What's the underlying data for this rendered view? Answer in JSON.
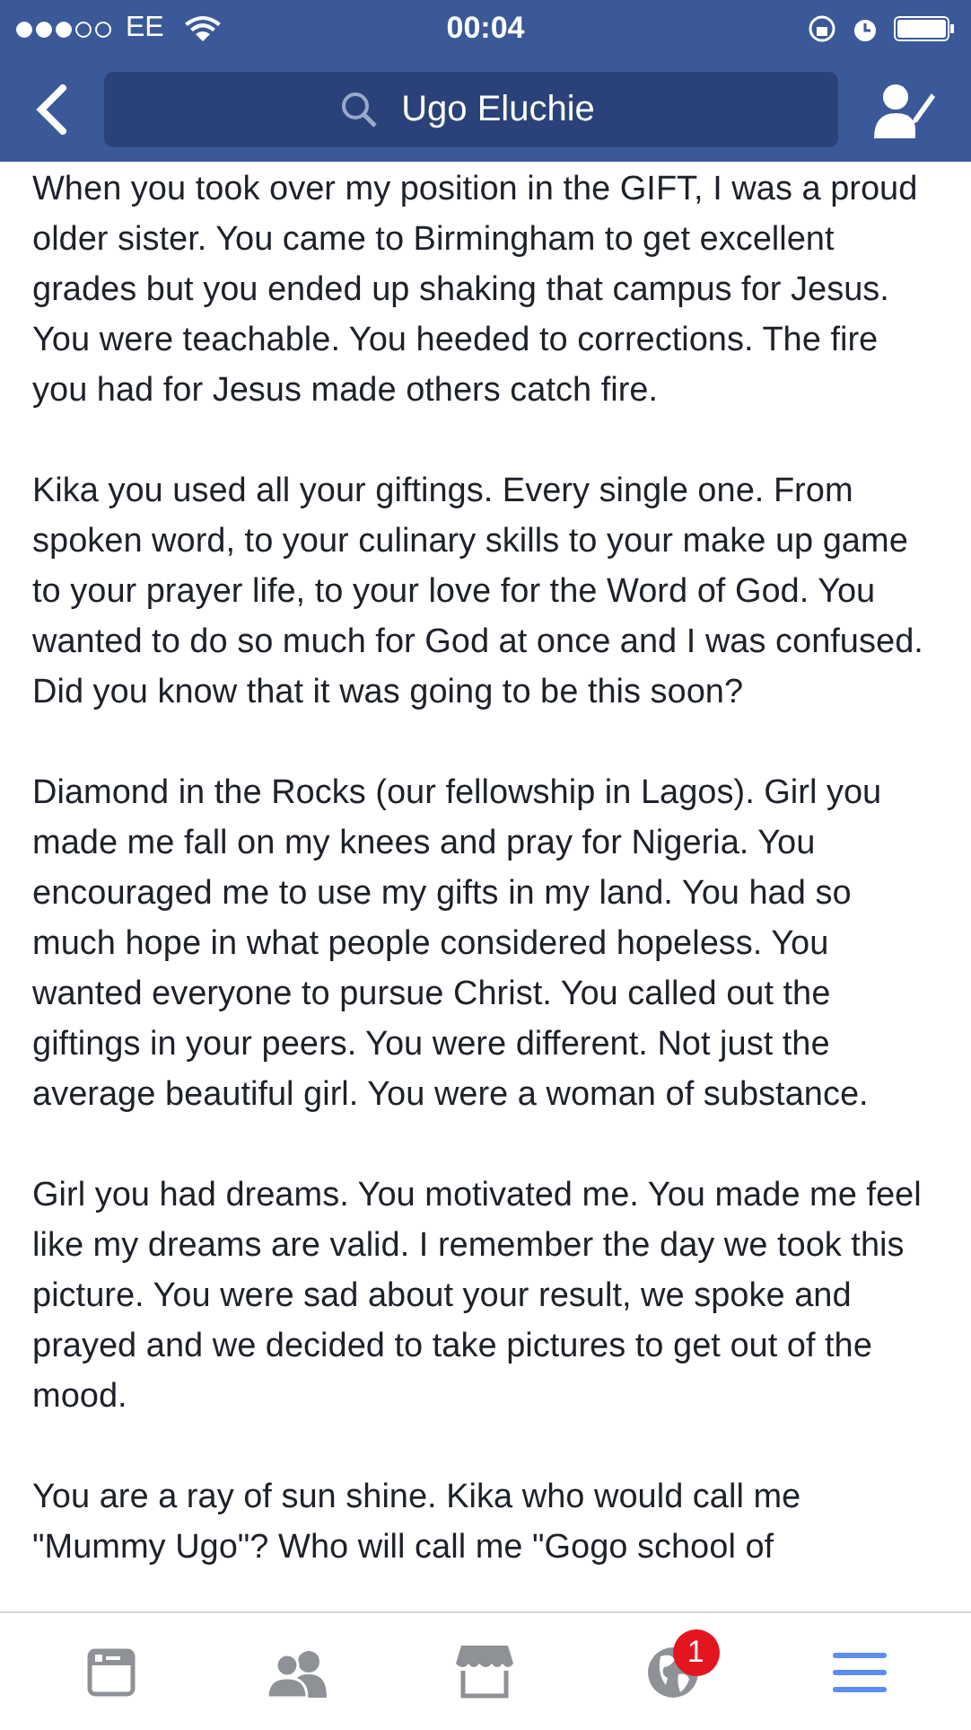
{
  "status_bar": {
    "carrier": "EE",
    "time": "00:04"
  },
  "nav_bar": {
    "search": {
      "value": "Ugo Eluchie"
    }
  },
  "post": {
    "paragraphs": [
      "When you took over my position in the GIFT, I was a proud older sister. You came to Birmingham to get excellent grades but you ended up shaking that campus for Jesus. You were teachable. You heeded to corrections. The fire you had for Jesus made others catch fire.",
      "Kika you used all your giftings. Every single one. From spoken word, to your culinary skills to your make up game to your prayer life, to your love for the Word of God. You wanted to do so much for God at once and I was confused. Did you know that it was going to be this soon?",
      "Diamond in the Rocks (our fellowship in Lagos). Girl you made me fall on my knees and pray for Nigeria. You encouraged me to use my gifts in my land. You had so much hope in what people considered hopeless. You wanted everyone to pursue Christ. You called out the giftings in your peers. You were different. Not just the average beautiful girl. You were a woman of substance.",
      "Girl you had dreams. You motivated me. You made me feel like my dreams are valid. I remember the day we took this picture. You were sad about your result, we spoke and prayed and we decided to take pictures to get out of the mood.",
      "You are a ray of sun shine. Kika who would call me \"Mummy Ugo\"? Who will call me \"Gogo school of"
    ]
  },
  "tab_bar": [
    {
      "kind": "feed",
      "selected": false
    },
    {
      "kind": "friends",
      "selected": false
    },
    {
      "kind": "marketplace",
      "selected": false
    },
    {
      "kind": "notifications",
      "selected": false,
      "badge": "1"
    },
    {
      "kind": "menu",
      "selected": true
    }
  ]
}
